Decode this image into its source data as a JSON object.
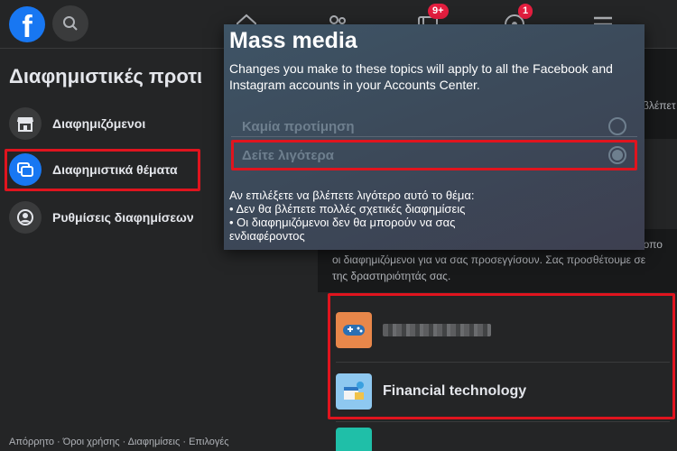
{
  "topbar": {
    "logo_letter": "f",
    "friends_badge": "",
    "groups_badge": "9+",
    "gaming_badge": "1"
  },
  "sidebar": {
    "title": "Διαφημιστικές προτι",
    "items": [
      {
        "label": "Διαφημιζόμενοι",
        "icon": "store-icon"
      },
      {
        "label": "Διαφημιστικά θέματα",
        "icon": "ad-topics-icon",
        "active": true
      },
      {
        "label": "Ρυθμίσεις διαφημίσεων",
        "icon": "user-circle-icon"
      }
    ],
    "footer": "Απόρρητο · Όροι χρήσης · Διαφημίσεις · Επιλογές"
  },
  "main": {
    "partial_right_top": "βλέπετ",
    "line1": "ίες σας οπο",
    "line2": "οι διαφημιζόμενοι για να σας προσεγγίσουν. Σας προσθέτουμε σε",
    "line3": "της δραστηριότητάς σας.",
    "topics": [
      {
        "name": "",
        "icon": "gamepad-icon",
        "color": "#e8874a"
      },
      {
        "name": "Financial technology",
        "icon": "fintech-icon",
        "color": "#8ec8f0"
      }
    ]
  },
  "popup": {
    "title": "Mass media",
    "description": "Changes you make to these topics will apply to all the Facebook and Instagram accounts in your Accounts Center.",
    "options": [
      {
        "label": "Καμία προτίμηση",
        "selected": false
      },
      {
        "label": "Δείτε λιγότερα",
        "selected": true
      }
    ],
    "note_heading": "Αν επιλέξετε να βλέπετε λιγότερο αυτό το θέμα:",
    "note_bullet1": "• Δεν θα βλέπετε πολλές σχετικές διαφημίσεις",
    "note_bullet2": "• Οι διαφημιζόμενοι δεν θα μπορούν να σας",
    "note_bullet2_cont": "ενδιαφέροντος"
  },
  "colors": {
    "accent": "#1877f2",
    "highlight": "#e0141e",
    "badge": "#e41e3f"
  }
}
